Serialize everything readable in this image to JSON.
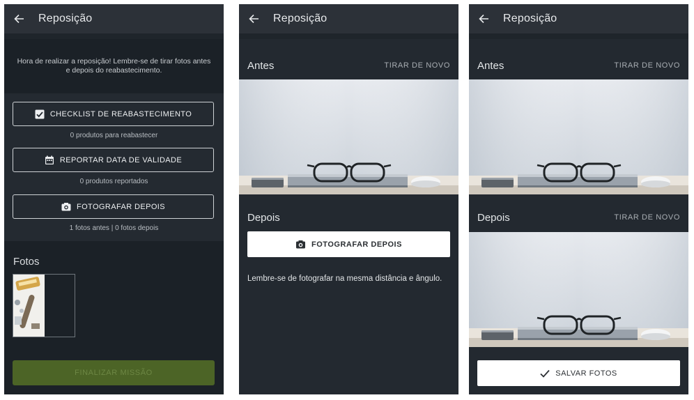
{
  "screens": [
    {
      "title": "Reposição",
      "intro": "Hora de realizar a reposição! Lembre-se de tirar fotos antes e depois do reabastecimento.",
      "buttons": [
        {
          "label": "CHECKLIST DE REABASTECIMENTO",
          "icon": "checkbox-icon",
          "sub": "0 produtos para reabastecer"
        },
        {
          "label": "REPORTAR DATA DE VALIDADE",
          "icon": "calendar-icon",
          "sub": "0 produtos reportados"
        },
        {
          "label": "FOTOGRAFAR DEPOIS",
          "icon": "camera-icon",
          "sub": "1 fotos antes | 0 fotos depois"
        }
      ],
      "fotos_title": "Fotos",
      "finalizar_label": "FINALIZAR MISSÃO"
    },
    {
      "title": "Reposição",
      "antes_label": "Antes",
      "retake_label": "TIRAR DE NOVO",
      "depois_label": "Depois",
      "photo_button_label": "FOTOGRAFAR DEPOIS",
      "hint": "Lembre-se de fotografar na mesma distância e ângulo."
    },
    {
      "title": "Reposição",
      "antes_label": "Antes",
      "antes_retake_label": "TIRAR DE NOVO",
      "depois_label": "Depois",
      "depois_retake_label": "TIRAR DE NOVO",
      "save_label": "SALVAR FOTOS"
    }
  ],
  "colors": {
    "background": "#232930",
    "appbar": "#2c3138",
    "finalizar_disabled": "#4c6426",
    "white_button": "#ffffff"
  }
}
